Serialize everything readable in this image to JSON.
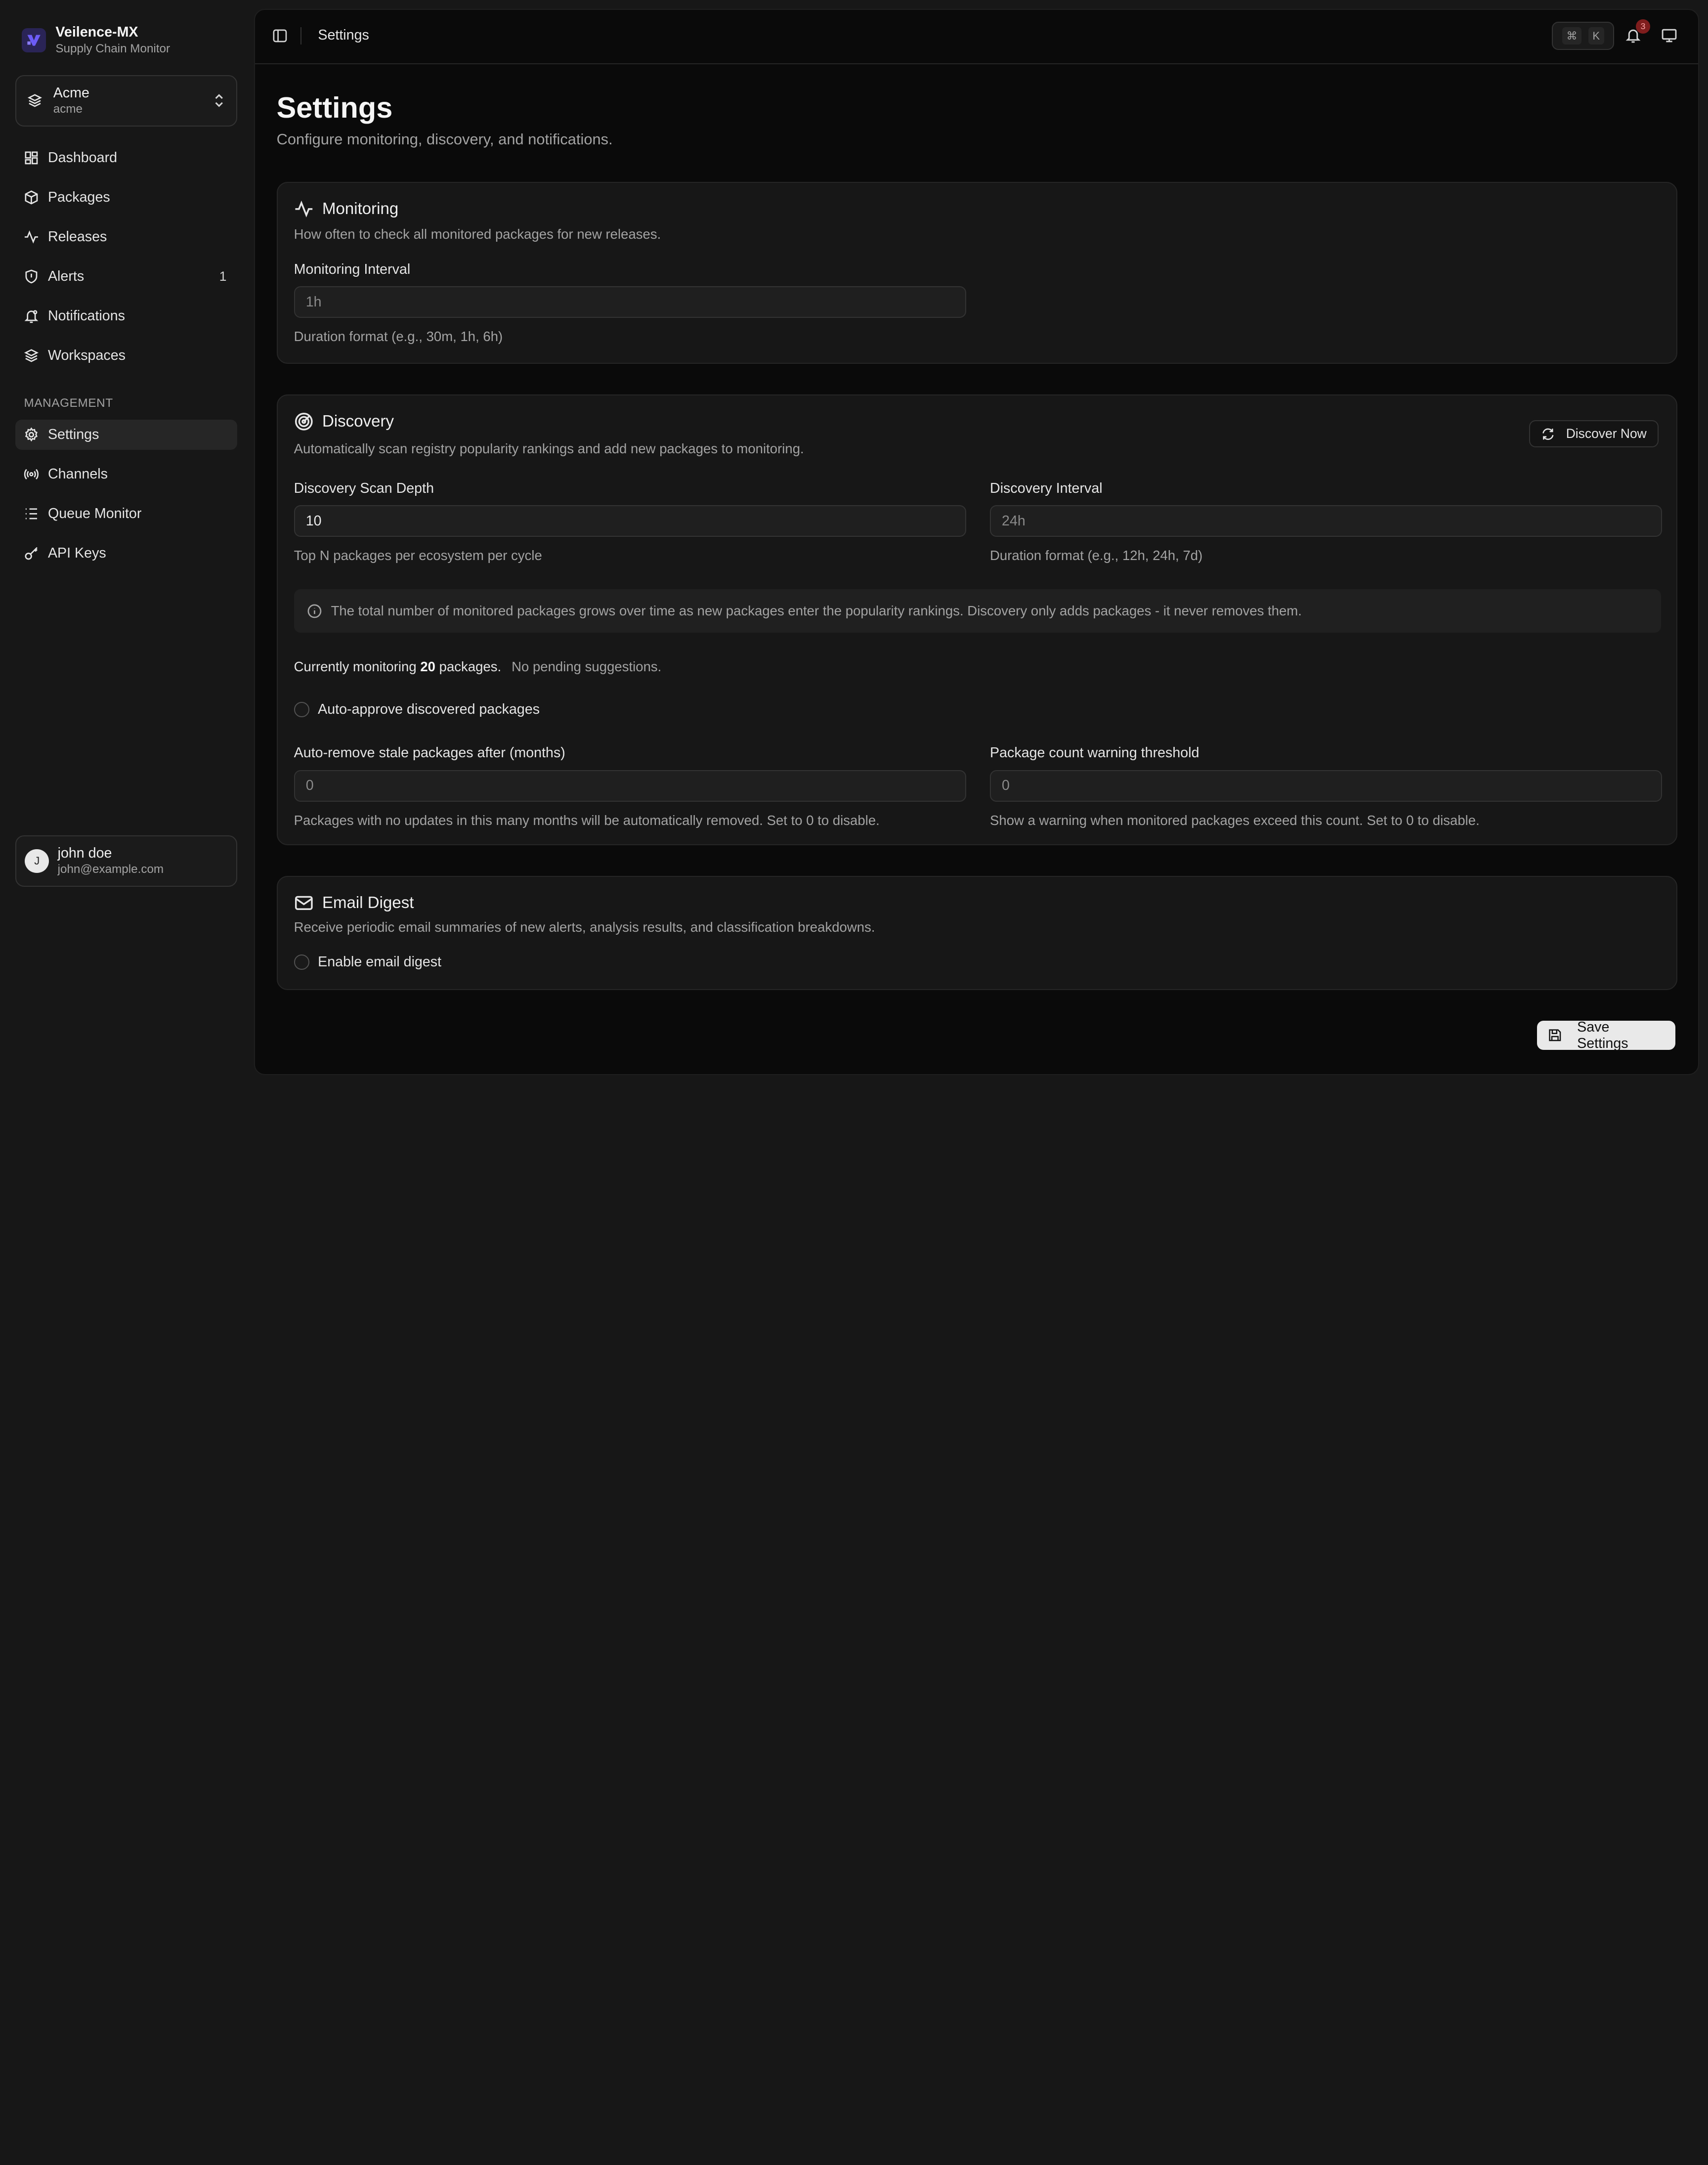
{
  "brand": {
    "name": "Veilence-MX",
    "subtitle": "Supply Chain Monitor"
  },
  "workspace": {
    "name": "Acme",
    "slug": "acme"
  },
  "nav": {
    "main": [
      {
        "label": "Dashboard",
        "icon": "grid-icon"
      },
      {
        "label": "Packages",
        "icon": "package-icon"
      },
      {
        "label": "Releases",
        "icon": "activity-icon"
      },
      {
        "label": "Alerts",
        "icon": "shield-icon",
        "count": "1"
      },
      {
        "label": "Notifications",
        "icon": "bell-icon"
      },
      {
        "label": "Workspaces",
        "icon": "layers-icon"
      }
    ],
    "management_label": "MANAGEMENT",
    "management": [
      {
        "label": "Settings",
        "icon": "gear-icon",
        "active": true
      },
      {
        "label": "Channels",
        "icon": "radio-icon"
      },
      {
        "label": "Queue Monitor",
        "icon": "list-icon"
      },
      {
        "label": "API Keys",
        "icon": "key-icon"
      }
    ]
  },
  "user": {
    "initial": "J",
    "name": "john doe",
    "email": "john@example.com"
  },
  "topbar": {
    "title": "Settings",
    "shortcut": [
      "⌘",
      "K"
    ],
    "notification_count": "3"
  },
  "page": {
    "title": "Settings",
    "subtitle": "Configure monitoring, discovery, and notifications."
  },
  "monitoring": {
    "title": "Monitoring",
    "description": "How often to check all monitored packages for new releases.",
    "interval_label": "Monitoring Interval",
    "interval_placeholder": "1h",
    "interval_hint": "Duration format (e.g., 30m, 1h, 6h)"
  },
  "discovery": {
    "title": "Discovery",
    "description": "Automatically scan registry popularity rankings and add new packages to monitoring.",
    "discover_button": "Discover Now",
    "scan_depth_label": "Discovery Scan Depth",
    "scan_depth_value": "10",
    "scan_depth_hint": "Top N packages per ecosystem per cycle",
    "interval_label": "Discovery Interval",
    "interval_placeholder": "24h",
    "interval_hint": "Duration format (e.g., 12h, 24h, 7d)",
    "info": "The total number of monitored packages grows over time as new packages enter the popularity rankings. Discovery only adds packages - it never removes them.",
    "status_prefix": "Currently monitoring",
    "status_count": "20",
    "status_suffix": "packages.",
    "status_pending": "No pending suggestions.",
    "auto_approve_label": "Auto-approve discovered packages",
    "stale_label": "Auto-remove stale packages after (months)",
    "stale_placeholder": "0",
    "stale_hint": "Packages with no updates in this many months will be automatically removed. Set to 0 to disable.",
    "threshold_label": "Package count warning threshold",
    "threshold_placeholder": "0",
    "threshold_hint": "Show a warning when monitored packages exceed this count. Set to 0 to disable."
  },
  "email_digest": {
    "title": "Email Digest",
    "description": "Receive periodic email summaries of new alerts, analysis results, and classification breakdowns.",
    "enable_label": "Enable email digest"
  },
  "save_button": "Save Settings",
  "colors": {
    "background": "#171717",
    "panel": "#0a0a0a",
    "card": "#171717",
    "accent": "#4f46e5",
    "badge": "#7f1d1d"
  }
}
